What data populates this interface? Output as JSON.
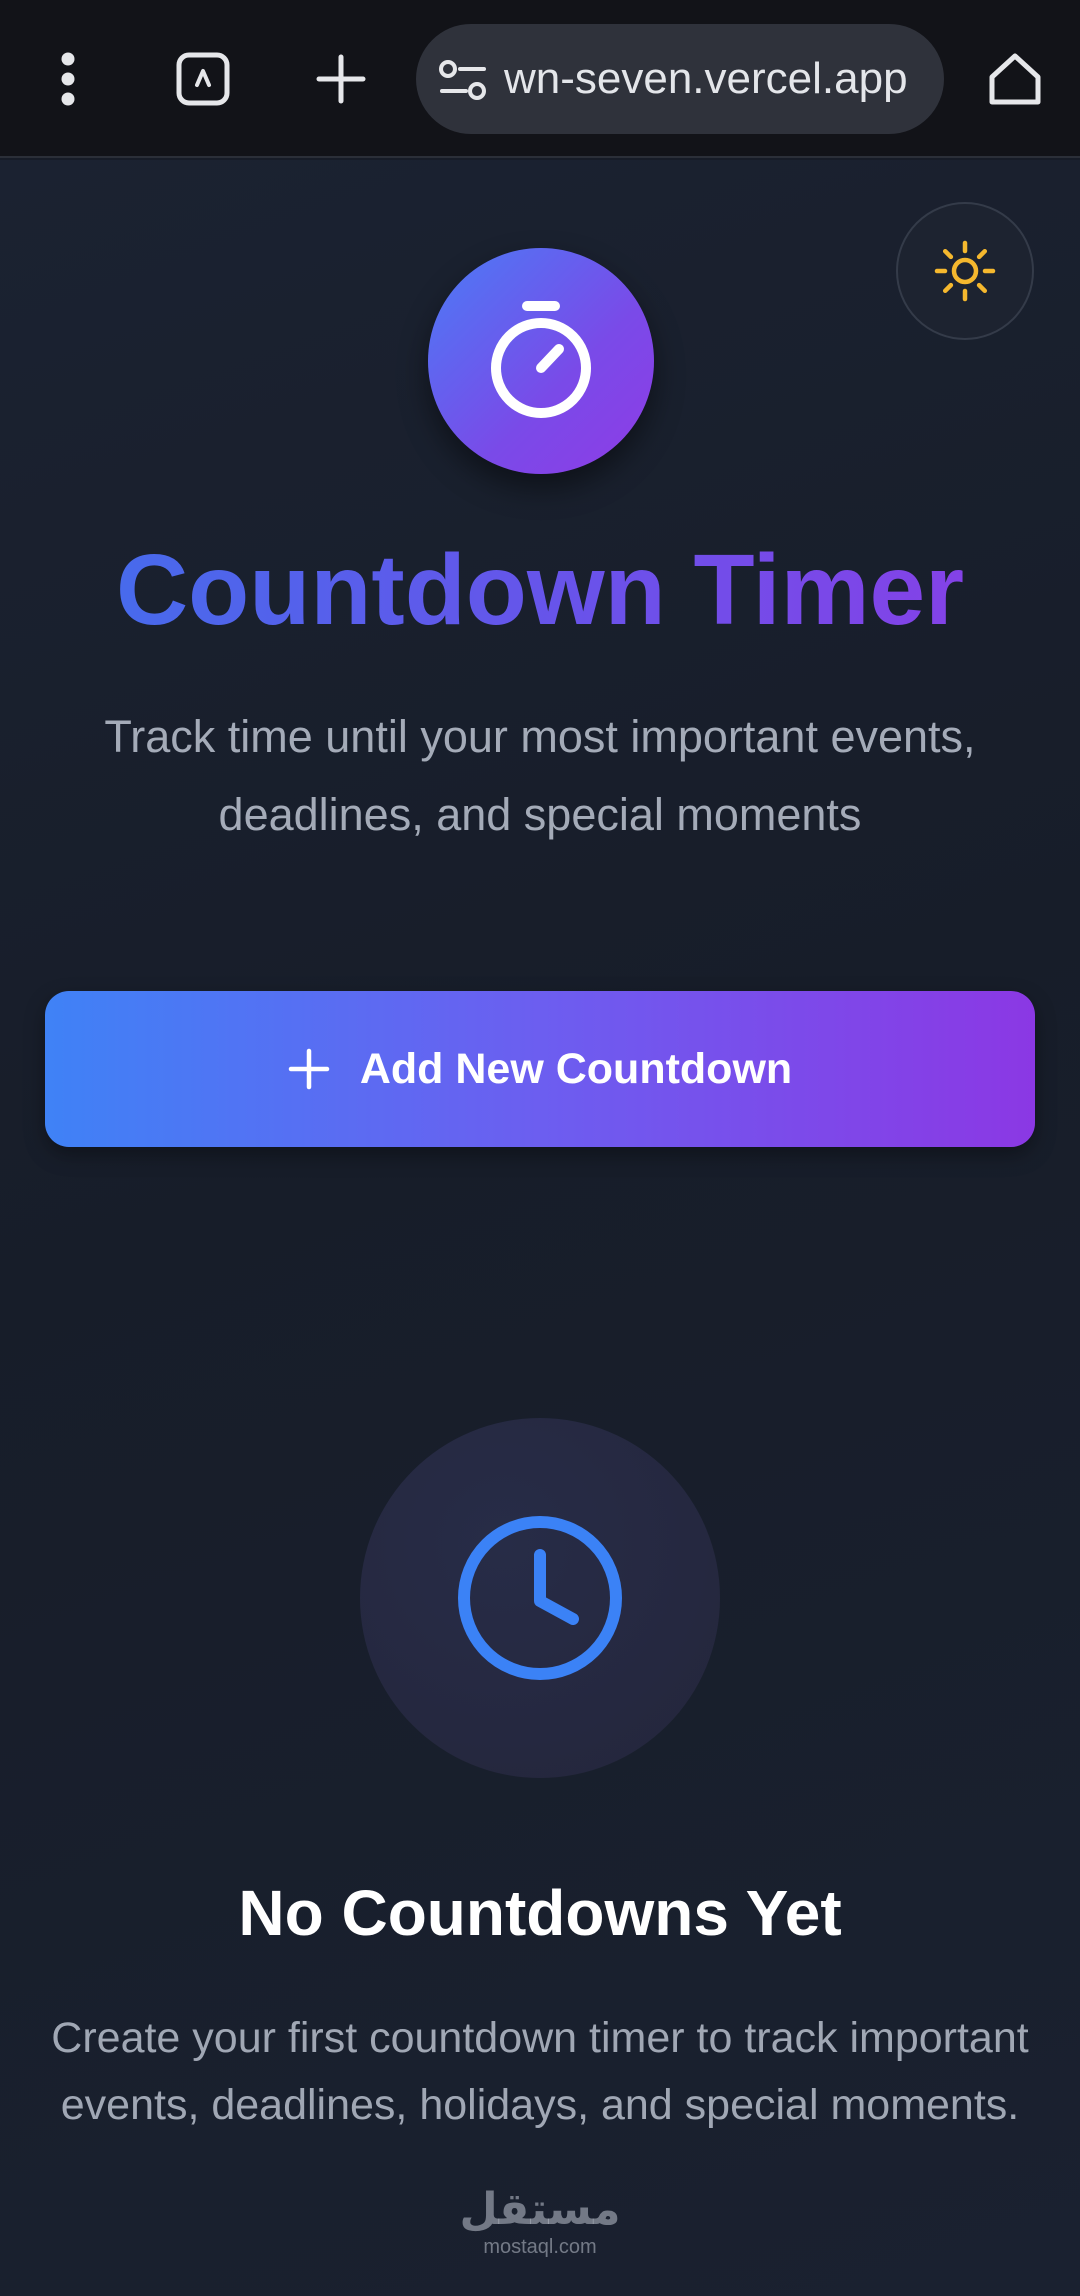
{
  "browser": {
    "url": "wn-seven.vercel.app",
    "icons": {
      "menu": "more-vert-icon",
      "tabs": "tab-switcher-icon",
      "new_tab": "plus-icon",
      "site_settings": "tune-icon",
      "home": "home-icon"
    }
  },
  "app": {
    "theme_toggle_icon": "sun-icon",
    "hero_icon": "stopwatch-icon",
    "title": "Countdown Timer",
    "subtitle": "Track time until your most important events, deadlines, and special moments",
    "add_button_label": "Add New Countdown",
    "empty_state": {
      "icon": "clock-icon",
      "title": "No Countdowns Yet",
      "description": "Create your first countdown timer to track important events, deadlines, holidays, and special moments."
    }
  },
  "watermark": {
    "arabic": "مستقل",
    "latin": "mostaql.com"
  },
  "colors": {
    "background": "#171c27",
    "accent_blue": "#3f82f6",
    "accent_purple": "#8b38e4",
    "sun": "#f5b82e",
    "empty_clock": "#3b82f6"
  }
}
